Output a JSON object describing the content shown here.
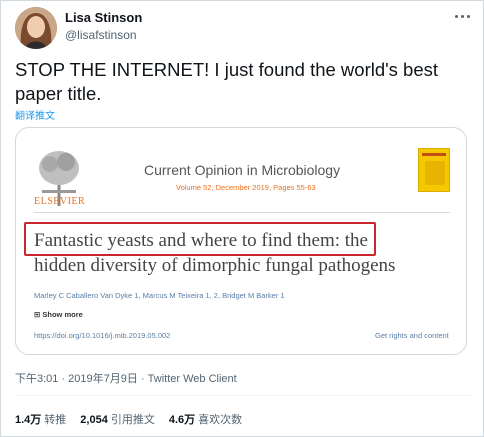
{
  "author": {
    "name": "Lisa Stinson",
    "handle": "@lisafstinson"
  },
  "tweet": {
    "text": "STOP THE INTERNET! I just found the world's best paper title.",
    "translate_label": "翻译推文"
  },
  "card": {
    "publisher": "ELSEVIER",
    "journal": "Current Opinion in Microbiology",
    "volume_line": "Volume 52, December 2019, Pages 55-63",
    "title_line1": "Fantastic yeasts and where to find them: the",
    "title_line2": "hidden diversity of dimorphic fungal pathogens",
    "authors": "Marley C Caballero Van Dyke 1, Marcus M Teixeira 1, 2, Bridget M Barker 1",
    "show_more": "Show more",
    "doi": "https://doi.org/10.1016/j.mib.2019.05.002",
    "rights": "Get rights and content"
  },
  "meta": "下午3:01 · 2019年7月9日 · Twitter Web Client",
  "stats": [
    {
      "count": "1.4万",
      "label": "转推"
    },
    {
      "count": "2,054",
      "label": "引用推文"
    },
    {
      "count": "4.6万",
      "label": "喜欢次数"
    }
  ],
  "colors": {
    "link": "#1d9bf0",
    "elsevier_orange": "#e9711c",
    "highlight_red": "#c8282d"
  }
}
